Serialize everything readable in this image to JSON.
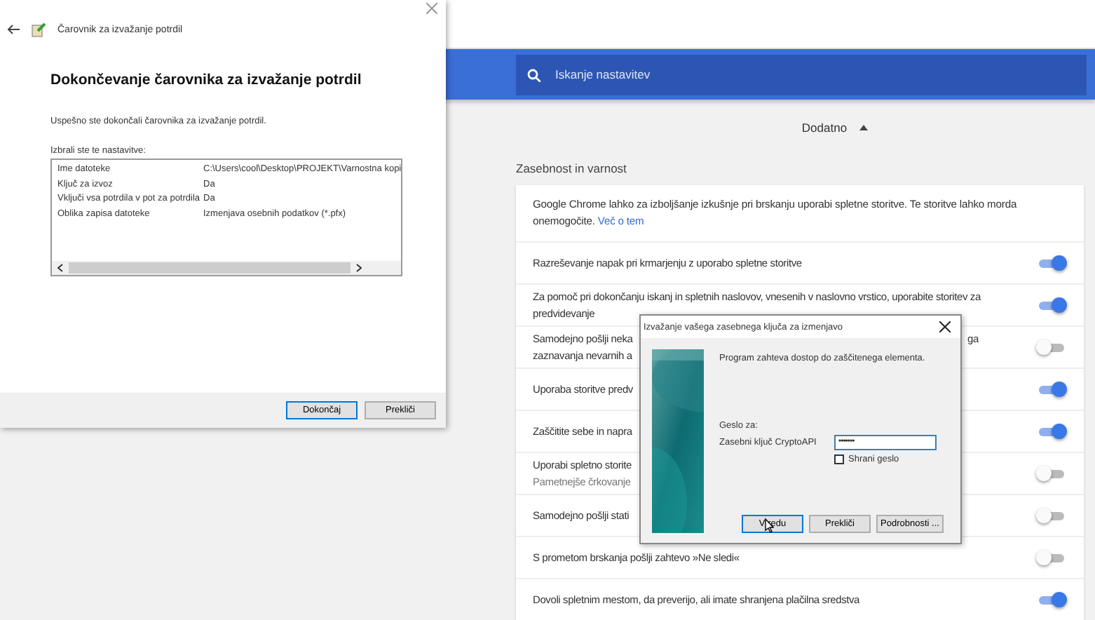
{
  "browser": {
    "search": {
      "placeholder": "Iskanje nastavitev"
    },
    "advanced": {
      "label": "Dodatno",
      "expanded": true
    },
    "section_title": "Zasebnost in varnost",
    "intro": {
      "text": "Google Chrome lahko za izboljšanje izkušnje pri brskanju uporabi spletne storitve. Te storitve lahko morda onemogočite.",
      "link": "Več o tem"
    },
    "settings": [
      {
        "lines": [
          "Razreševanje napak pri krmarjenju z uporabo spletne storitve"
        ],
        "on": true
      },
      {
        "lines": [
          "Za pomoč pri dokončanju iskanj in spletnih naslovov, vnesenih v naslovno vrstico, uporabite storitev za predvidevanje"
        ],
        "on": true
      },
      {
        "lines": [
          "Samodejno pošlji neka",
          "zaznavanja nevarnih a"
        ],
        "tail": "ga",
        "on": false
      },
      {
        "lines": [
          "Uporaba storitve predv"
        ],
        "on": true
      },
      {
        "lines": [
          "Zaščitite sebe in napra"
        ],
        "on": true
      },
      {
        "lines": [
          "Uporabi spletno storite"
        ],
        "sub": "Pametnejše črkovanje",
        "on": false
      },
      {
        "lines": [
          "Samodejno pošlji stati"
        ],
        "on": false
      },
      {
        "lines": [
          "S prometom brskanja pošlji zahtevo »Ne sledi«"
        ],
        "on": false
      },
      {
        "lines": [
          "Dovoli spletnim mestom, da preverijo, ali imate shranjena plačilna sredstva"
        ],
        "on": true
      }
    ]
  },
  "wizard": {
    "title": "Čarovnik za izvažanje potrdil",
    "heading": "Dokončevanje čarovnika za izvažanje potrdil",
    "message": "Uspešno ste dokončali čarovnika za izvažanje potrdil.",
    "list_label": "Izbrali ste te nastavitve:",
    "settings": [
      {
        "name": "Ime datoteke",
        "value": "C:\\Users\\cool\\Desktop\\PROJEKT\\Varnostna kopi"
      },
      {
        "name": "Ključ za izvoz",
        "value": "Da"
      },
      {
        "name": "Vključi vsa potrdila v pot za potrdila",
        "value": "Da"
      },
      {
        "name": "Oblika zapisa datoteke",
        "value": "Izmenjava osebnih podatkov (*.pfx)"
      }
    ],
    "buttons": [
      {
        "label": "Dokončaj",
        "default": true
      },
      {
        "label": "Prekliči",
        "default": false
      }
    ]
  },
  "dialog": {
    "title": "Izvažanje vašega zasebnega ključa za izmenjavo",
    "message": "Program zahteva dostop do zaščitenega elementa.",
    "password_for": "Geslo za:",
    "key_name": "Zasebni ključ CryptoAPI",
    "password": "•••••••",
    "remember": {
      "label": "Shrani geslo",
      "checked": false
    },
    "buttons": [
      {
        "label": "V redu",
        "default": true
      },
      {
        "label": "Prekliči",
        "default": false
      },
      {
        "label": "Podrobnosti ...",
        "default": false
      }
    ]
  }
}
